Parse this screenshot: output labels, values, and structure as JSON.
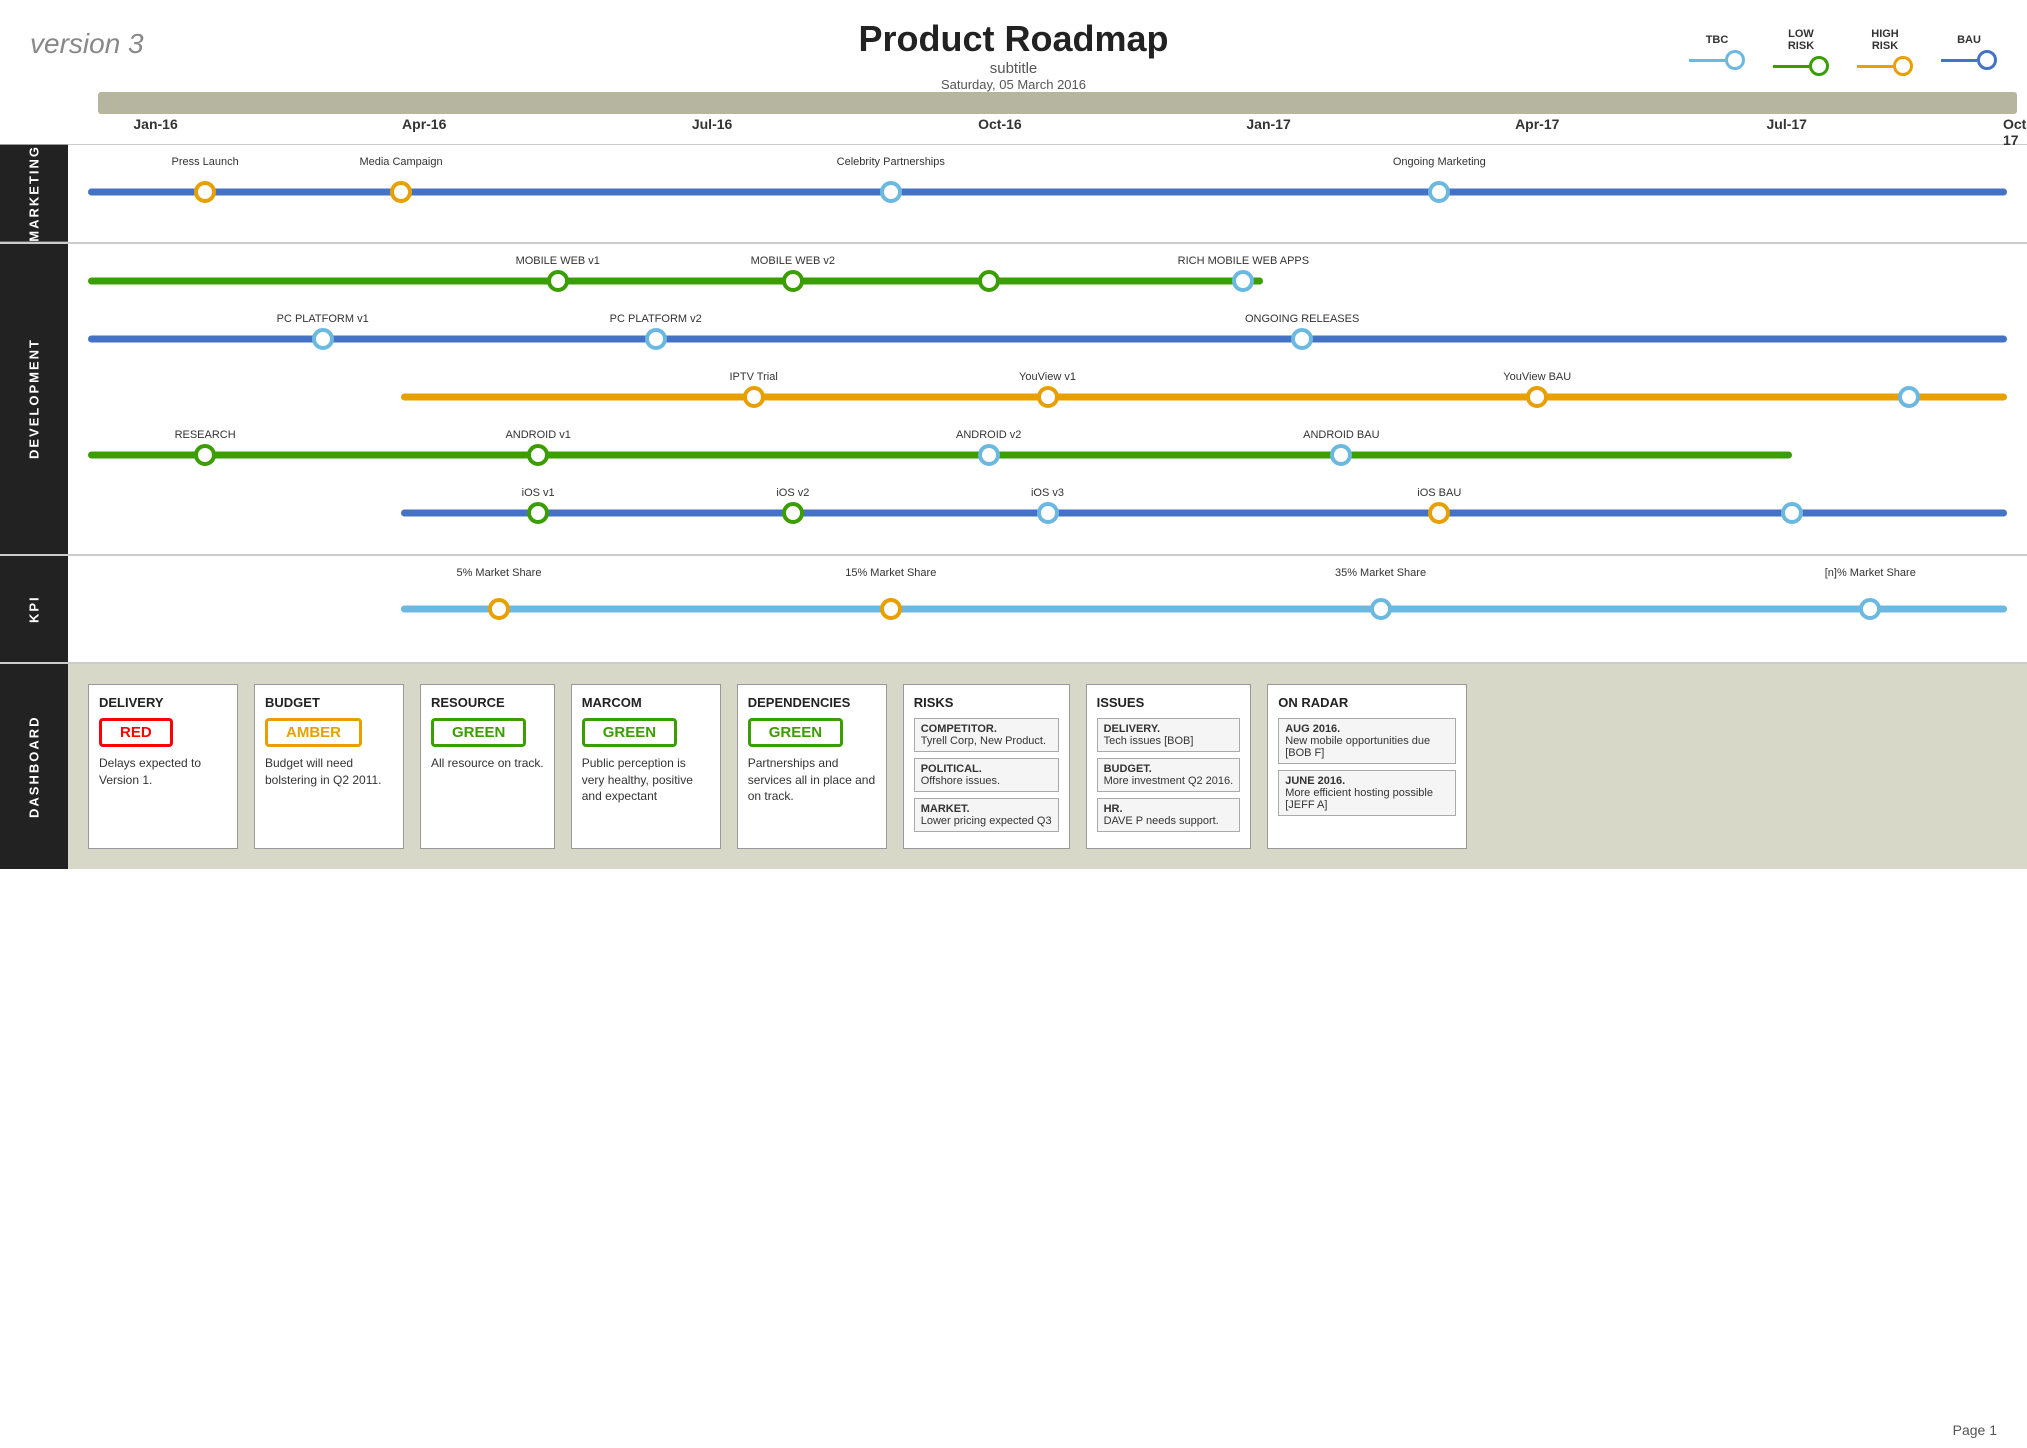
{
  "header": {
    "version": "version 3",
    "title": "Product Roadmap",
    "subtitle": "subtitle",
    "date": "Saturday, 05 March 2016"
  },
  "legend": {
    "items": [
      {
        "id": "tbc",
        "label": "TBC",
        "color": "#6bb8e0",
        "line_color": "#6bb8e0"
      },
      {
        "id": "low_risk",
        "label": "LOW\nRISK",
        "color": "#3a9e00",
        "line_color": "#3a9e00"
      },
      {
        "id": "high_risk",
        "label": "HIGH\nRISK",
        "color": "#e8a000",
        "line_color": "#e8a000"
      },
      {
        "id": "bau",
        "label": "BAU",
        "color": "#4472c4",
        "line_color": "#4472c4"
      }
    ]
  },
  "timeline": {
    "months": [
      {
        "label": "Jan-16",
        "pct": 0.03
      },
      {
        "label": "Apr-16",
        "pct": 0.17
      },
      {
        "label": "Jul-16",
        "pct": 0.32
      },
      {
        "label": "Oct-16",
        "pct": 0.47
      },
      {
        "label": "Jan-17",
        "pct": 0.61
      },
      {
        "label": "Apr-17",
        "pct": 0.75
      },
      {
        "label": "Jul-17",
        "pct": 0.88
      },
      {
        "label": "Oct-17",
        "pct": 1.0
      }
    ]
  },
  "sections": {
    "marketing": {
      "label": "MARKETING",
      "rows": [
        {
          "bar_start": 0.01,
          "bar_end": 0.99,
          "bar_color": "#4472c4",
          "dots": [
            {
              "pos": 0.07,
              "color": "#e8a000",
              "label_top": "Press\nLaunch",
              "label_align": "center"
            },
            {
              "pos": 0.17,
              "color": "#e8a000",
              "label_top": "Media\nCampaign",
              "label_align": "center"
            },
            {
              "pos": 0.42,
              "color": "#6bb8e0",
              "label_top": "Celebrity Partnerships",
              "label_align": "center"
            },
            {
              "pos": 0.7,
              "color": "#6bb8e0",
              "label_top": "Ongoing Marketing",
              "label_align": "center"
            }
          ]
        }
      ]
    },
    "development": {
      "label": "DEVELOPMENT",
      "rows": [
        {
          "bar_start": 0.01,
          "bar_end": 0.61,
          "bar_color": "#3a9e00",
          "dots": [
            {
              "pos": 0.25,
              "color": "#3a9e00",
              "label_top": "MOBILE WEB v1",
              "label_align": "center"
            },
            {
              "pos": 0.37,
              "color": "#3a9e00",
              "label_top": "MOBILE WEB v2",
              "label_align": "center"
            },
            {
              "pos": 0.47,
              "color": "#3a9e00",
              "label_top": null,
              "label_align": "center"
            },
            {
              "pos": 0.6,
              "color": "#6bb8e0",
              "label_top": "RICH MOBILE WEB APPS",
              "label_align": "center"
            }
          ]
        },
        {
          "bar_start": 0.01,
          "bar_end": 0.99,
          "bar_color": "#4472c4",
          "dots": [
            {
              "pos": 0.13,
              "color": "#6bb8e0",
              "label_top": "PC PLATFORM v1",
              "label_align": "center"
            },
            {
              "pos": 0.3,
              "color": "#6bb8e0",
              "label_top": "PC PLATFORM v2",
              "label_align": "center"
            },
            {
              "pos": 0.63,
              "color": "#6bb8e0",
              "label_top": "ONGOING RELEASES",
              "label_align": "center"
            }
          ]
        },
        {
          "bar_start": 0.17,
          "bar_end": 0.99,
          "bar_color": "#e8a000",
          "dots": [
            {
              "pos": 0.35,
              "color": "#e8a000",
              "label_top": "IPTV Trial",
              "label_align": "center"
            },
            {
              "pos": 0.5,
              "color": "#e8a000",
              "label_top": "YouView v1",
              "label_align": "center"
            },
            {
              "pos": 0.75,
              "color": "#e8a000",
              "label_top": "YouView BAU",
              "label_align": "center"
            },
            {
              "pos": 0.94,
              "color": "#6bb8e0",
              "label_top": null,
              "label_align": "center"
            }
          ]
        },
        {
          "bar_start": 0.01,
          "bar_end": 0.88,
          "bar_color": "#3a9e00",
          "dots": [
            {
              "pos": 0.07,
              "color": "#3a9e00",
              "label_top": "RESEARCH",
              "label_align": "left"
            },
            {
              "pos": 0.24,
              "color": "#3a9e00",
              "label_top": "ANDROID v1",
              "label_align": "center"
            },
            {
              "pos": 0.47,
              "color": "#6bb8e0",
              "label_top": "ANDROID v2",
              "label_align": "center"
            },
            {
              "pos": 0.65,
              "color": "#6bb8e0",
              "label_top": "ANDROID BAU",
              "label_align": "center"
            }
          ]
        },
        {
          "bar_start": 0.17,
          "bar_end": 0.99,
          "bar_color": "#4472c4",
          "dots": [
            {
              "pos": 0.24,
              "color": "#3a9e00",
              "label_top": "iOS v1",
              "label_align": "center"
            },
            {
              "pos": 0.37,
              "color": "#3a9e00",
              "label_top": "iOS v2",
              "label_align": "center"
            },
            {
              "pos": 0.5,
              "color": "#6bb8e0",
              "label_top": "iOS v3",
              "label_align": "center"
            },
            {
              "pos": 0.7,
              "color": "#e8a000",
              "label_top": "iOS BAU",
              "label_align": "center"
            },
            {
              "pos": 0.88,
              "color": "#6bb8e0",
              "label_top": null,
              "label_align": "center"
            }
          ]
        }
      ]
    },
    "kpi": {
      "label": "KPI",
      "rows": [
        {
          "bar_start": 0.17,
          "bar_end": 0.99,
          "bar_color": "#6bb8e0",
          "dots": [
            {
              "pos": 0.22,
              "color": "#e8a000",
              "label_top": "5% Market\nShare",
              "label_align": "center"
            },
            {
              "pos": 0.42,
              "color": "#e8a000",
              "label_top": "15% Market Share",
              "label_align": "center"
            },
            {
              "pos": 0.67,
              "color": "#6bb8e0",
              "label_top": "35% Market Share",
              "label_align": "center"
            },
            {
              "pos": 0.92,
              "color": "#6bb8e0",
              "label_top": "[n]% Market Share",
              "label_align": "center"
            }
          ]
        }
      ]
    }
  },
  "dashboard": {
    "label": "DASHBOARD",
    "cards": [
      {
        "id": "delivery",
        "title": "DELIVERY",
        "badge": "RED",
        "badge_type": "red",
        "text": "Delays expected to Version 1."
      },
      {
        "id": "budget",
        "title": "BUDGET",
        "badge": "AMBER",
        "badge_type": "amber",
        "text": "Budget will need bolstering in Q2 2011."
      },
      {
        "id": "resource",
        "title": "RESOURCE",
        "badge": "GREEN",
        "badge_type": "green",
        "text": "All resource on track."
      },
      {
        "id": "marcom",
        "title": "MARCOM",
        "badge": "GREEN",
        "badge_type": "green",
        "text": "Public perception is very healthy, positive and expectant"
      },
      {
        "id": "dependencies",
        "title": "DEPENDENCIES",
        "badge": "GREEN",
        "badge_type": "green",
        "text": "Partnerships and services all in place and on track."
      }
    ],
    "risks": {
      "title": "RISKS",
      "items": [
        {
          "title": "COMPETITOR.",
          "text": "Tyrell Corp, New Product."
        },
        {
          "title": "POLITICAL.",
          "text": "Offshore issues."
        },
        {
          "title": "MARKET.",
          "text": "Lower pricing expected Q3"
        }
      ]
    },
    "issues": {
      "title": "ISSUES",
      "items": [
        {
          "title": "DELIVERY.",
          "text": "Tech issues [BOB]"
        },
        {
          "title": "BUDGET.",
          "text": "More investment Q2 2016."
        },
        {
          "title": "HR.",
          "text": "DAVE P needs support."
        }
      ]
    },
    "on_radar": {
      "title": "ON RADAR",
      "items": [
        {
          "title": "AUG 2016.",
          "text": "New mobile opportunities due [BOB F]"
        },
        {
          "title": "JUNE 2016.",
          "text": "More efficient hosting possible [JEFF A]"
        }
      ]
    }
  },
  "footer": {
    "page": "Page 1"
  }
}
